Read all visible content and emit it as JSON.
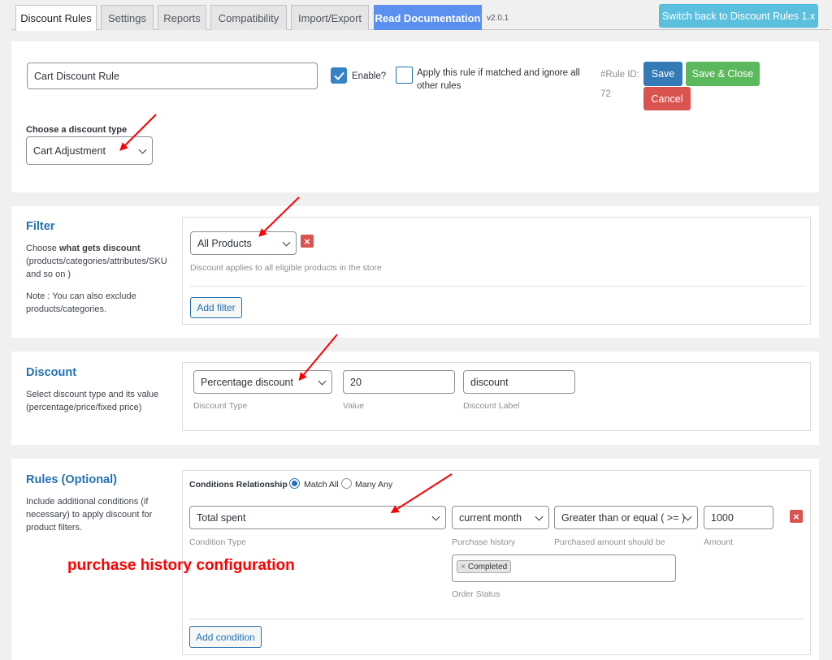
{
  "tabs": {
    "discount_rules": "Discount Rules",
    "settings": "Settings",
    "reports": "Reports",
    "compatibility": "Compatibility",
    "import_export": "Import/Export",
    "read_documentation": "Read Documentation"
  },
  "version": "v2.0.1",
  "switch_back": "Switch back to Discount Rules 1.x",
  "rule": {
    "name_value": "Cart Discount Rule",
    "enable_label": "Enable?",
    "enable_checked": true,
    "apply_ignore_label_line1": "Apply this rule if matched and ignore all",
    "apply_ignore_label_line2": "other rules",
    "apply_ignore_checked": false,
    "rule_id_label": "#Rule ID:",
    "rule_id_value": "72",
    "save": "Save",
    "save_close": "Save & Close",
    "cancel": "Cancel",
    "discount_type_label": "Choose a discount type",
    "discount_type_value": "Cart Adjustment"
  },
  "filter": {
    "title": "Filter",
    "desc_prefix": "Choose ",
    "desc_bold": "what gets discount",
    "desc_line2": "(products/categories/attributes/SKU",
    "desc_line3": "and so on )",
    "note_line1": "Note : You can also exclude",
    "note_line2": "products/categories.",
    "select_value": "All Products",
    "hint": "Discount applies to all eligible products in the store",
    "add_filter": "Add filter"
  },
  "discount": {
    "title": "Discount",
    "desc_line1": "Select discount type and its value",
    "desc_line2": "(percentage/price/fixed price)",
    "type_value": "Percentage discount",
    "type_hint": "Discount Type",
    "value": "20",
    "value_hint": "Value",
    "label_value": "discount",
    "label_hint": "Discount Label"
  },
  "rules": {
    "title": "Rules (Optional)",
    "desc_line1": "Include additional conditions (if",
    "desc_line2": "necessary) to apply discount for",
    "desc_line3": "product filters.",
    "conditions_relationship": "Conditions Relationship",
    "match_all": "Match All",
    "many_any": "Many Any",
    "match_all_selected": true,
    "condition_type_value": "Total spent",
    "condition_type_hint": "Condition Type",
    "purchase_history_value": "current month",
    "purchase_history_hint": "Purchase history",
    "comparison_value": "Greater than or equal ( >= )",
    "comparison_hint": "Purchased amount should be",
    "amount_value": "1000",
    "amount_hint": "Amount",
    "order_status_tag": "Completed",
    "order_status_hint": "Order Status",
    "add_condition": "Add condition"
  },
  "annotation": {
    "text": "purchase history configuration",
    "color": "#ff0000"
  },
  "colors": {
    "primary": "#2271b1",
    "save": "#337ab7",
    "save_close": "#5cb85c",
    "cancel": "#d9534f",
    "switch": "#5bc0de",
    "doc_tab": "#5b8ff0"
  }
}
